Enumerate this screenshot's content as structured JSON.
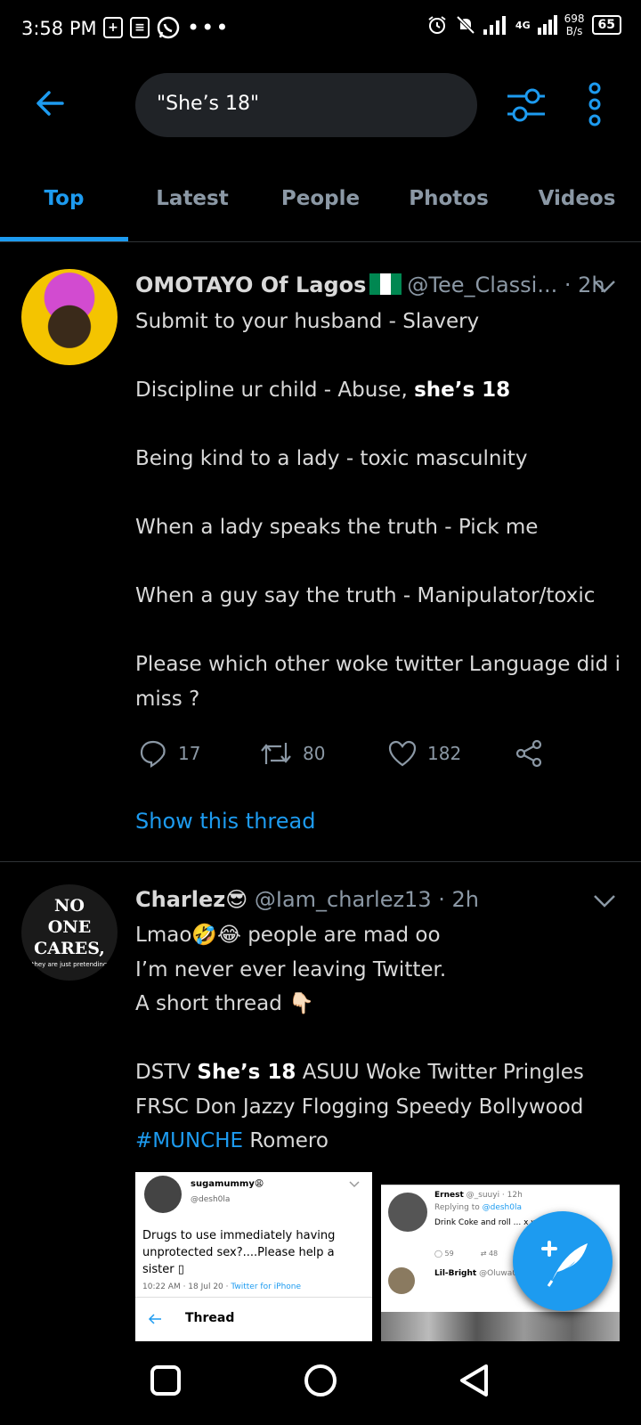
{
  "status_bar": {
    "time": "3:58 PM",
    "network_label": "4G",
    "speed_value": "698",
    "speed_unit": "B/s",
    "battery": "65"
  },
  "search": {
    "query": "\"She’s 18\""
  },
  "tabs": [
    "Top",
    "Latest",
    "People",
    "Photos",
    "Videos"
  ],
  "tweets": [
    {
      "name": "OMOTAYO Of Lagos",
      "handle": "@Tee_Classi...",
      "time": "· 2h",
      "lines": {
        "l1": "Submit to your husband - Slavery",
        "l2a": "Discipline ur child - Abuse, ",
        "l2b": "she’s 18",
        "l3": "Being kind to a lady - toxic masculnity",
        "l4": "When a lady speaks the truth - Pick me",
        "l5": "When a guy say the truth - Manipulator/toxic",
        "l6": "Please which other woke twitter Language did i miss ?"
      },
      "replies": "17",
      "retweets": "80",
      "likes": "182",
      "thread_link": "Show this thread"
    },
    {
      "name": "Charlez😎",
      "handle": "@Iam_charlez13",
      "time": "· 2h",
      "avatar_text": {
        "line1": "NO",
        "line2": "ONE",
        "line3": "CARES,",
        "line4": "they are just pretending"
      },
      "lines": {
        "l1": "Lmao🤣😂 people are mad oo",
        "l2": "I’m never ever leaving Twitter.",
        "l3": "A short thread 👇🏻",
        "l4a": "DSTV ",
        "l4b": "She’s 18",
        "l4c": " ASUU Woke Twitter Pringles FRSC Don Jazzy Flogging Speedy Bollywood ",
        "l4d": "#MUNCHE",
        "l4e": " Romero"
      },
      "embed1": {
        "name": "sugamummy😩",
        "handle": "@desh0la",
        "text": "Drugs to use immediately having unprotected sex?....Please help a sister ▯",
        "meta": "10:22 AM · 18 Jul 20 · ",
        "client": "Twitter for iPhone",
        "nav_label": "Thread"
      },
      "embed2": {
        "name": "Ernest",
        "handle": "@_suuyi · 12h",
        "reply_prefix": "Replying to ",
        "reply_handle": "@desh0la",
        "text": "Drink Coke and roll ... x wall",
        "replies": "59",
        "retweets": "48",
        "name2": "Lil-Bright",
        "handle2": "@Oluwa07"
      }
    }
  ],
  "colors": {
    "accent": "#1d9bf0",
    "background": "#000000",
    "muted": "#8b98a5"
  }
}
